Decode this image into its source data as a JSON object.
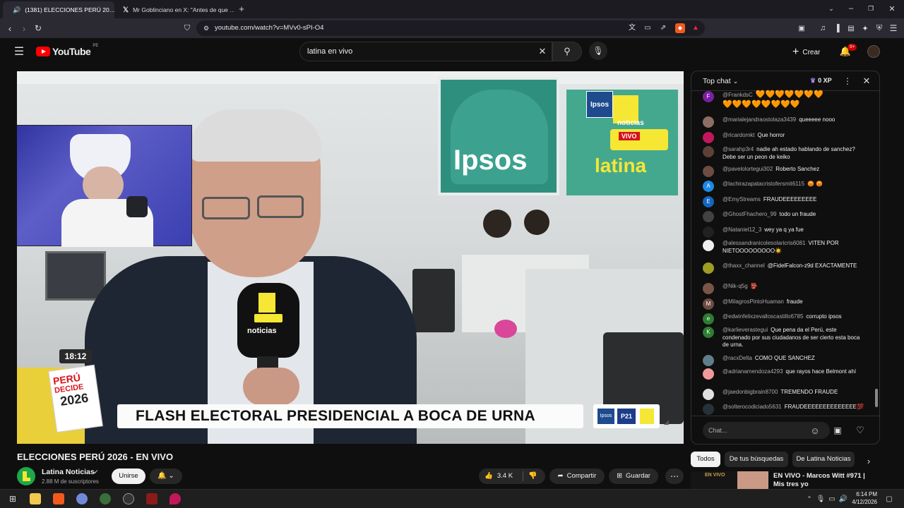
{
  "browser": {
    "tabs": [
      {
        "label": "(1381) ELECCIONES PERÚ 20…",
        "active": true
      },
      {
        "label": "Mr Goblinciano en X: \"Antes de que …",
        "active": false
      }
    ],
    "new_tab": "+",
    "url": "youtube.com/watch?v=MVv0-sPI-O4"
  },
  "youtube": {
    "logo": "YouTube",
    "region": "PE",
    "search_value": "latina en vivo",
    "create_label": "Crear",
    "notif_count": "9+"
  },
  "video": {
    "clock": "18:12",
    "banner": "FLASH ELECTORAL PRESIDENCIAL A BOCA DE URNA",
    "badge_top": "Ipsos",
    "noticias": "noticias",
    "vivo": "VIVO",
    "latina": "latina",
    "wall_brand": "Ipsos",
    "peru_decide_1": "PERÚ",
    "peru_decide_2": "DECIDE",
    "peru_decide_3": "2026",
    "mic_noticias": "noticias",
    "p21": "P21"
  },
  "meta": {
    "title": "ELECCIONES PERÚ 2026 - EN VIVO",
    "channel": "Latina Noticias",
    "subs": "2.88 M de suscriptores",
    "join": "Unirse",
    "likes": "3.4 K",
    "share": "Compartir",
    "save": "Guardar"
  },
  "chat": {
    "header": "Top chat",
    "xp": "0 XP",
    "input_placeholder": "Chat...",
    "messages": [
      {
        "author": "@FrankdsC",
        "text": "🧡🧡🧡🧡🧡🧡🧡",
        "initial": "F",
        "color": "#7b1fa2"
      },
      {
        "author": "",
        "text": "🧡🧡🧡🧡🧡🧡🧡🧡",
        "initial": "",
        "color": ""
      },
      {
        "author": "@marialejandraostolaza3439",
        "text": "queeeee nooo",
        "initial": "",
        "color": "#8d6e63"
      },
      {
        "author": "@ricardomkt",
        "text": "Que horror",
        "initial": "",
        "color": "#c2185b"
      },
      {
        "author": "@sarahp3r4",
        "text": "nadie ah estado hablando de sanchez? Debe ser un peon de keiko",
        "initial": "",
        "color": "#5d4037"
      },
      {
        "author": "@pavelolortegui302",
        "text": "Roberto Sanchez",
        "initial": "",
        "color": "#6d4c41"
      },
      {
        "author": "@lachirazapatacristofersmit6115",
        "text": "😡 😡",
        "initial": "A",
        "color": "#1e88e5"
      },
      {
        "author": "@EmyStreams",
        "text": "FRAUDEEEEEEEEE",
        "initial": "E",
        "color": "#1565c0"
      },
      {
        "author": "@GhostFhachero_99",
        "text": "todo un fraude",
        "initial": "",
        "color": "#424242"
      },
      {
        "author": "@Nataniel12_3",
        "text": "wey ya q ya fue",
        "initial": "",
        "color": "#212121"
      },
      {
        "author": "@alessandranicolesolaricris6081",
        "text": "VITEN POR NIETOOOOOOOOO☀️",
        "initial": "",
        "color": "#eeeeee"
      },
      {
        "author": "@thaxx_channel",
        "text": "@FidelFalcon-z9d EXACTAMENTE",
        "initial": "",
        "color": "#9e9d24"
      },
      {
        "author": "@Nik-q5g",
        "text": "👺",
        "initial": "",
        "color": "#795548"
      },
      {
        "author": "@MilagrosPintoHuaman",
        "text": "fraude",
        "initial": "M",
        "color": "#6d4c41"
      },
      {
        "author": "@edwinfelixzevalloscastillo6785",
        "text": "corrupto ipsos",
        "initial": "e",
        "color": "#2e7d32"
      },
      {
        "author": "@karlieverastegui",
        "text": "Que pena da el Perú, este condenado por sus ciudadanos de ser cierto esta boca de urna.",
        "initial": "K",
        "color": "#2e7d32"
      },
      {
        "author": "@racxDelta",
        "text": "COMO QUE SANCHEZ",
        "initial": "",
        "color": "#607d8b"
      },
      {
        "author": "@adrianamendoza4293",
        "text": "que rayos hace Belmont ahí",
        "initial": "",
        "color": "#ef9a9a"
      },
      {
        "author": "@jaedonbigbrain8700",
        "text": "TREMENDO FRAUDE",
        "initial": "",
        "color": "#e0e0e0"
      },
      {
        "author": "@solterocodiciado5631",
        "text": "FRAUDEEEEEEEEEEEEEE💯",
        "initial": "",
        "color": "#263238"
      }
    ]
  },
  "below_chat": {
    "chips": [
      "Todos",
      "De tus búsquedas",
      "De Latina Noticias"
    ],
    "rec_title": "EN VIVO - Marcos Witt #971 | Mis tres yo",
    "rec_thumb": "EN VIVO"
  },
  "taskbar": {
    "time": "6:14 PM",
    "date": "4/12/2026"
  }
}
